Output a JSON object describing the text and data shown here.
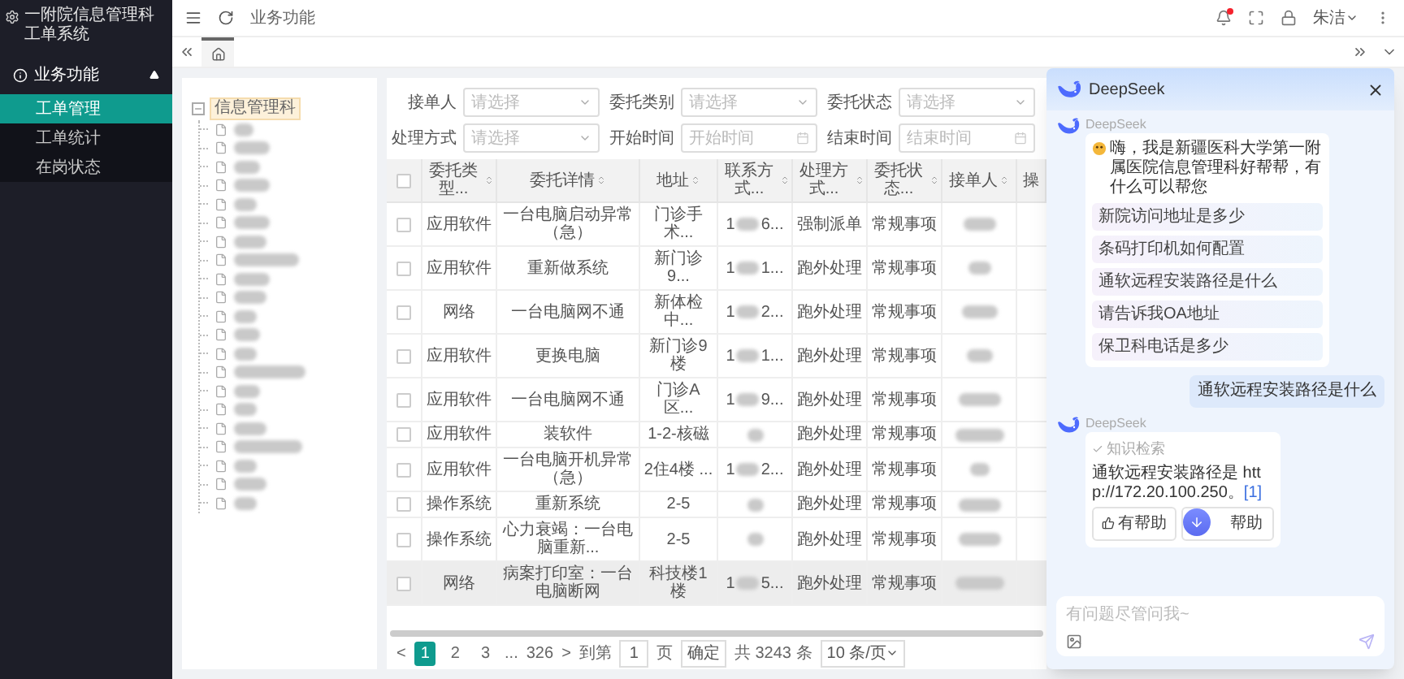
{
  "sidebar": {
    "title": "一附院信息管理科工单系统",
    "menu": [
      {
        "label": "业务功能",
        "expanded": true,
        "children": [
          {
            "label": "工单管理",
            "selected": true
          },
          {
            "label": "工单统计",
            "selected": false
          },
          {
            "label": "在岗状态",
            "selected": false
          }
        ]
      }
    ]
  },
  "topbar": {
    "breadcrumb": "业务功能",
    "notification_dot": true,
    "user": "朱洁"
  },
  "tree": {
    "label": "信息管理科",
    "expanded": true,
    "children": [
      {
        "kind": "redacted"
      },
      {
        "kind": "redacted"
      },
      {
        "kind": "redacted"
      },
      {
        "kind": "redacted"
      },
      {
        "kind": "redacted"
      },
      {
        "kind": "redacted"
      },
      {
        "kind": "redacted"
      },
      {
        "kind": "redacted"
      },
      {
        "kind": "redacted"
      },
      {
        "kind": "redacted"
      },
      {
        "kind": "redacted"
      },
      {
        "kind": "redacted"
      },
      {
        "kind": "redacted"
      },
      {
        "kind": "redacted"
      },
      {
        "kind": "redacted"
      },
      {
        "kind": "redacted"
      },
      {
        "kind": "redacted"
      },
      {
        "kind": "redacted"
      },
      {
        "kind": "redacted"
      },
      {
        "kind": "redacted"
      },
      {
        "kind": "redacted"
      }
    ]
  },
  "filters": [
    {
      "label": "接单人",
      "placeholder": "请选择",
      "kind": "select"
    },
    {
      "label": "委托类别",
      "placeholder": "请选择",
      "kind": "select"
    },
    {
      "label": "委托状态",
      "placeholder": "请选择",
      "kind": "select"
    },
    {
      "label": "处理方式",
      "placeholder": "请选择",
      "kind": "select"
    },
    {
      "label": "开始时间",
      "placeholder": "开始时间",
      "kind": "date"
    },
    {
      "label": "结束时间",
      "placeholder": "结束时间",
      "kind": "date"
    }
  ],
  "table": {
    "all_checked": false,
    "columns": [
      {
        "label": "委托类型...",
        "sortable": true
      },
      {
        "label": "委托详情",
        "sortable": true
      },
      {
        "label": "地址",
        "sortable": true
      },
      {
        "label": "联系方式...",
        "sortable": true
      },
      {
        "label": "处理方式...",
        "sortable": true
      },
      {
        "label": "委托状态...",
        "sortable": true
      },
      {
        "label": "接单人",
        "sortable": true
      },
      {
        "label": "操",
        "sortable": false
      }
    ],
    "rows": [
      {
        "checked": false,
        "hovered": false,
        "type": "应用软件",
        "detail": "一台电脑启动异常（急）",
        "address": "门诊手术...",
        "contact_start": "1",
        "contact_end": "6...",
        "method": "强制派单",
        "status": "常规事项"
      },
      {
        "checked": false,
        "hovered": false,
        "type": "应用软件",
        "detail": "重新做系统",
        "address": "新门诊9...",
        "contact_start": "1",
        "contact_end": "1...",
        "method": "跑外处理",
        "status": "常规事项"
      },
      {
        "checked": false,
        "hovered": false,
        "type": "网络",
        "detail": "一台电脑网不通",
        "address": "新体检中...",
        "contact_start": "1",
        "contact_end": "2...",
        "method": "跑外处理",
        "status": "常规事项"
      },
      {
        "checked": false,
        "hovered": false,
        "type": "应用软件",
        "detail": "更换电脑",
        "address": "新门诊9楼",
        "contact_start": "1",
        "contact_end": "1...",
        "method": "跑外处理",
        "status": "常规事项"
      },
      {
        "checked": false,
        "hovered": false,
        "type": "应用软件",
        "detail": "一台电脑网不通",
        "address": "门诊A区...",
        "contact_start": "1",
        "contact_end": "9...",
        "method": "跑外处理",
        "status": "常规事项"
      },
      {
        "checked": false,
        "hovered": false,
        "type": "应用软件",
        "detail": "装软件",
        "address": "1-2-核磁",
        "method": "跑外处理",
        "status": "常规事项"
      },
      {
        "checked": false,
        "hovered": false,
        "type": "应用软件",
        "detail": "一台电脑开机异常（急）",
        "address": "2住4楼 ...",
        "contact_start": "1",
        "contact_end": "2...",
        "method": "跑外处理",
        "status": "常规事项"
      },
      {
        "checked": false,
        "hovered": false,
        "type": "操作系统",
        "detail": "重新系统",
        "address": "2-5",
        "method": "跑外处理",
        "status": "常规事项"
      },
      {
        "checked": false,
        "hovered": false,
        "type": "操作系统",
        "detail": "心力衰竭：一台电脑重新...",
        "address": "2-5",
        "method": "跑外处理",
        "status": "常规事项"
      },
      {
        "checked": false,
        "hovered": true,
        "type": "网络",
        "detail": "病案打印室：一台电脑断网",
        "address": "科技楼1楼",
        "contact_start": "1",
        "contact_end": "5...",
        "method": "跑外处理",
        "status": "常规事项"
      }
    ]
  },
  "pagination": {
    "prev": "<",
    "pages": [
      {
        "label": "1",
        "selected": true
      },
      {
        "label": "2",
        "selected": false
      },
      {
        "label": "3",
        "selected": false
      }
    ],
    "ellipsis": "...",
    "last": "326",
    "next": ">",
    "goto_label": "到第",
    "goto_value": "1",
    "page_unit": "页",
    "confirm": "确定",
    "total": "共 3243 条",
    "page_size": "10 条/页"
  },
  "chat": {
    "title": "DeepSeek",
    "messages": [
      {
        "kind": "bot",
        "sender": "DeepSeek",
        "text": "嗨，我是新疆医科大学第一附属医院信息管理科好帮帮，有什么可以帮您",
        "suggestions": [
          "新院访问地址是多少",
          "条码打印机如何配置",
          "通软远程安装路径是什么",
          "请告诉我OA地址",
          "保卫科电话是多少"
        ]
      },
      {
        "kind": "user",
        "text": "通软远程安装路径是什么"
      },
      {
        "kind": "answer",
        "sender": "DeepSeek",
        "status": "知识检索",
        "text": "通软远程安装路径是 http://172.20.100.250。",
        "ref": "[1]",
        "buttons": [
          "有帮助",
          "帮助"
        ]
      }
    ],
    "input": {
      "placeholder": "有问题尽管问我~"
    }
  }
}
